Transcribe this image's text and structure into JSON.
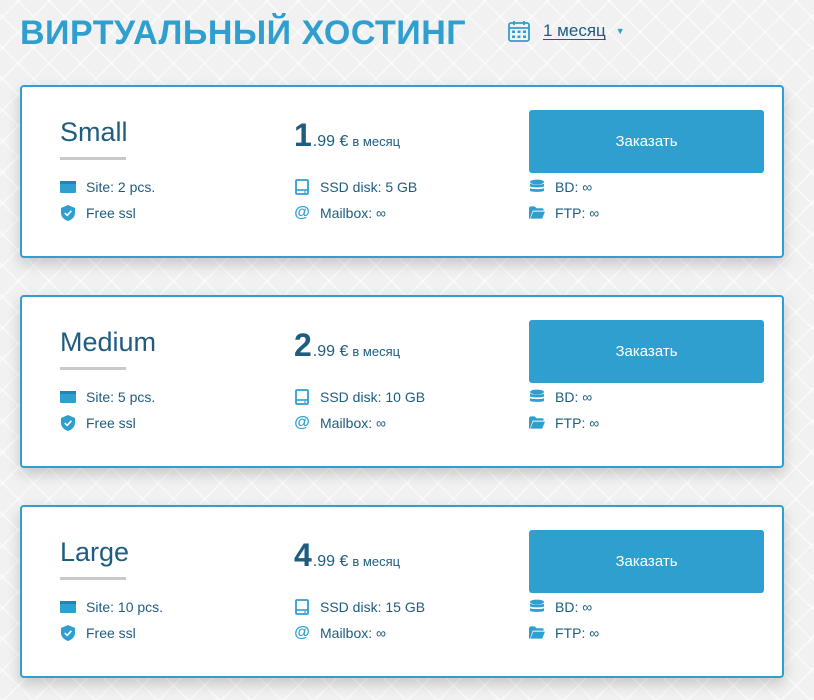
{
  "header": {
    "title": "ВИРТУАЛЬНЫЙ ХОСТИНГ",
    "period_label": "1 месяц",
    "period_icon": "calendar-icon",
    "caret_icon": "caret-down-icon"
  },
  "colors": {
    "accent": "#2e9fcf",
    "text": "#1e5c80",
    "card_bg": "#ffffff",
    "page_bg": "#f1f1f1"
  },
  "plans": [
    {
      "name": "Small",
      "price_int": "1",
      "price_frac": ".99 €",
      "price_unit": "в месяц",
      "button_label": "Заказать",
      "features": {
        "sites": "Site: 2 pcs.",
        "ssl": "Free ssl",
        "ssd": "SSD disk: 5 GB",
        "mailbox": "Mailbox: ∞",
        "bd": "BD: ∞",
        "ftp": "FTP: ∞"
      }
    },
    {
      "name": "Medium",
      "price_int": "2",
      "price_frac": ".99 €",
      "price_unit": "в месяц",
      "button_label": "Заказать",
      "features": {
        "sites": "Site: 5 pcs.",
        "ssl": "Free ssl",
        "ssd": "SSD disk: 10 GB",
        "mailbox": "Mailbox: ∞",
        "bd": "BD: ∞",
        "ftp": "FTP: ∞"
      }
    },
    {
      "name": "Large",
      "price_int": "4",
      "price_frac": ".99 €",
      "price_unit": "в месяц",
      "button_label": "Заказать",
      "features": {
        "sites": "Site: 10 pcs.",
        "ssl": "Free ssl",
        "ssd": "SSD disk: 15 GB",
        "mailbox": "Mailbox: ∞",
        "bd": "BD: ∞",
        "ftp": "FTP: ∞"
      }
    }
  ]
}
